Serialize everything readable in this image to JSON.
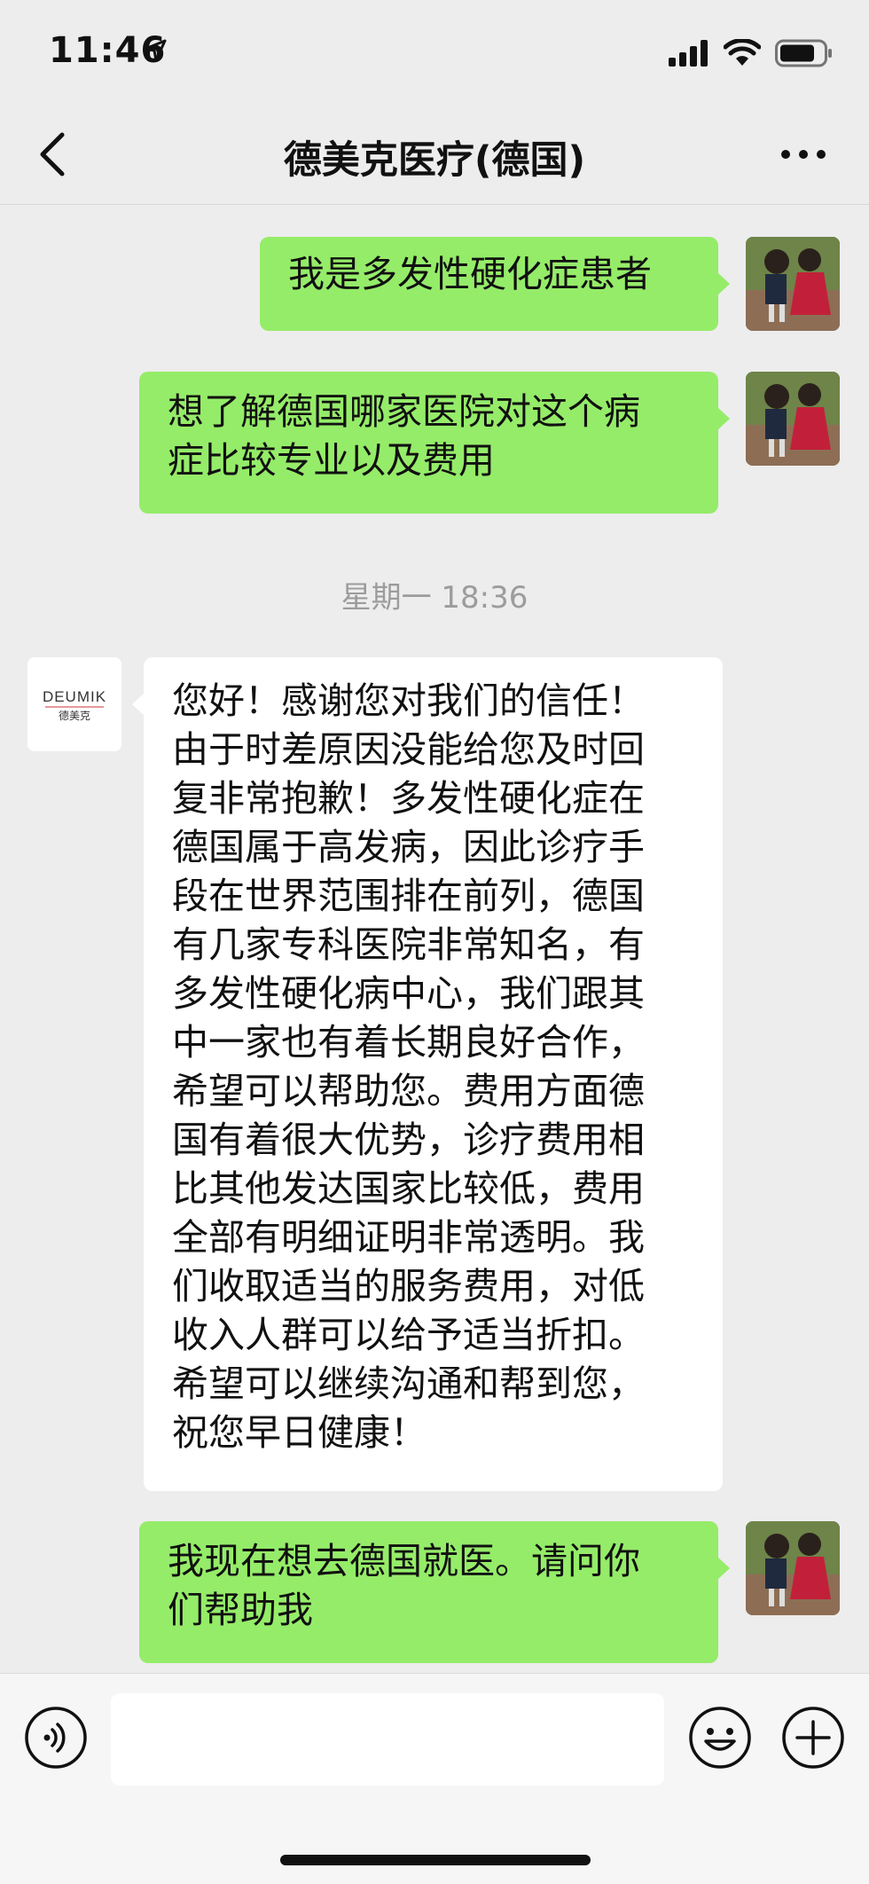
{
  "status_bar": {
    "time": "11:46",
    "location_icon": "location-arrow-icon",
    "icons": [
      "cellular-signal-icon",
      "wifi-icon",
      "battery-icon"
    ]
  },
  "nav": {
    "title": "德美克医疗(德国)",
    "back_icon": "chevron-left-icon",
    "more_icon": "more-dots-icon"
  },
  "messages": [
    {
      "side": "out",
      "text": "我是多发性硬化症患者"
    },
    {
      "side": "out",
      "text": "想了解德国哪家医院对这个病\n症比较专业以及费用"
    },
    {
      "side": "in",
      "text": "您好！感谢您对我们的信任！\n由于时差原因没能给您及时回\n复非常抱歉！多发性硬化症在\n德国属于高发病，因此诊疗手\n段在世界范围排在前列，德国\n有几家专科医院非常知名，有\n多发性硬化病中心，我们跟其\n中一家也有着长期良好合作，\n希望可以帮助您。费用方面德\n国有着很大优势，诊疗费用相\n比其他发达国家比较低，费用\n全部有明细证明非常透明。我\n们收取适当的服务费用，对低\n收入人群可以给予适当折扣。\n希望可以继续沟通和帮到您，\n祝您早日健康！"
    },
    {
      "side": "out",
      "text": "我现在想去德国就医。请问你\n们帮助我"
    }
  ],
  "timestamp": "星期一 18:36",
  "contact_logo": {
    "brand": "DEUMIK",
    "subtitle": "德美克"
  },
  "input_bar": {
    "placeholder": "",
    "voice_icon": "voice-icon",
    "emoji_icon": "emoji-icon",
    "plus_icon": "plus-icon"
  },
  "colors": {
    "background": "#ededed",
    "outgoing_bubble": "#95ec69",
    "incoming_bubble": "#ffffff",
    "timestamp_text": "#9c9c9c"
  }
}
